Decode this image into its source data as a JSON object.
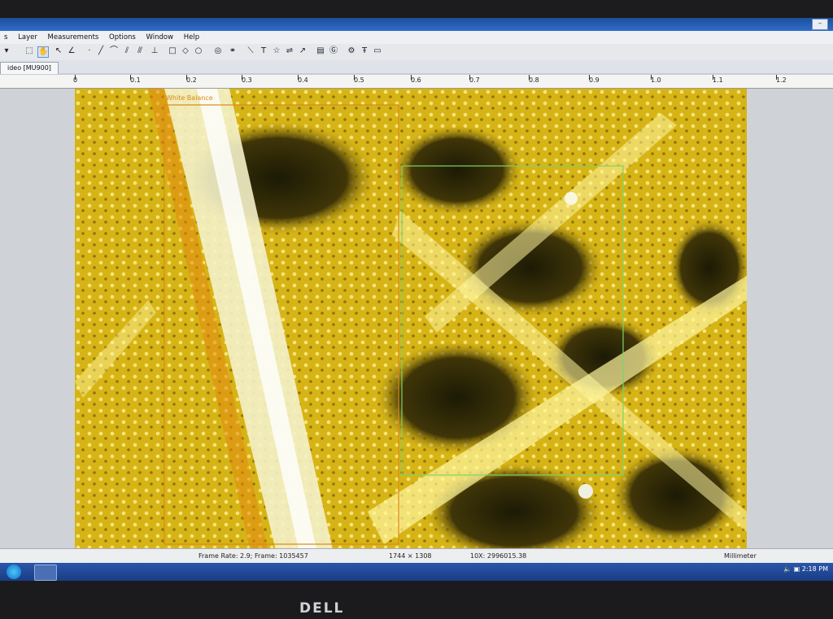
{
  "menubar": {
    "items": [
      "s",
      "Layer",
      "Measurements",
      "Options",
      "Window",
      "Help"
    ]
  },
  "document_tab": {
    "label": "ideo [MU900]"
  },
  "ruler": {
    "labels": [
      "0",
      "0.1",
      "0.2",
      "0.3",
      "0.4",
      "0.5",
      "0.6",
      "0.7",
      "0.8",
      "0.9",
      "1.0",
      "1.1",
      "1.2"
    ]
  },
  "overlay": {
    "white_balance_label": "White Balance",
    "color_orange": "#d98a1a",
    "color_green": "#7fd36a"
  },
  "status": {
    "frame_rate": "Frame Rate: 2.9; Frame: 1035457",
    "resolution": "1744 × 1308",
    "zoom": "10X: 2996015.38",
    "unit": "Millimeter"
  },
  "system": {
    "clock": "2:18 PM"
  },
  "bezel": {
    "brand": "DELL"
  },
  "colors": {
    "titlebar": "#2f6ccc",
    "taskbar": "#1a3d86",
    "specimen": "#e6c21c"
  }
}
